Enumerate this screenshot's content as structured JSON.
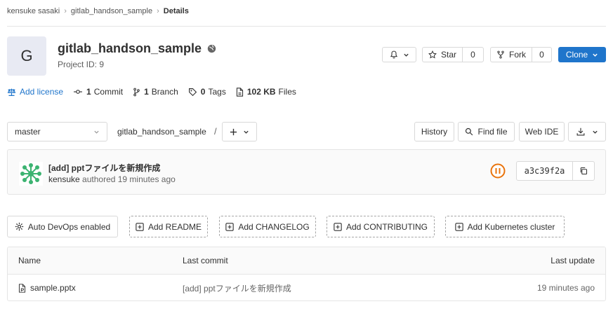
{
  "breadcrumb": {
    "items": [
      "kensuke sasaki",
      "gitlab_handson_sample"
    ],
    "current": "Details"
  },
  "project": {
    "avatar_letter": "G",
    "name": "gitlab_handson_sample",
    "id_label": "Project ID: 9"
  },
  "header_actions": {
    "star_label": "Star",
    "star_count": "0",
    "fork_label": "Fork",
    "fork_count": "0",
    "clone_label": "Clone"
  },
  "stats": {
    "add_license": "Add license",
    "commits_count": "1",
    "commits_label": "Commit",
    "branches_count": "1",
    "branches_label": "Branch",
    "tags_count": "0",
    "tags_label": "Tags",
    "files_size": "102 KB",
    "files_label": "Files"
  },
  "repo_nav": {
    "branch": "master",
    "path": "gitlab_handson_sample",
    "path_sep": "/",
    "history": "History",
    "find_file": "Find file",
    "web_ide": "Web IDE"
  },
  "last_commit": {
    "message": "[add] pptファイルを新規作成",
    "author": "kensuke",
    "meta": "authored 19 minutes ago",
    "sha": "a3c39f2a"
  },
  "quick_actions": {
    "auto_devops": "Auto DevOps enabled",
    "add_readme": "Add README",
    "add_changelog": "Add CHANGELOG",
    "add_contributing": "Add CONTRIBUTING",
    "add_kubernetes": "Add Kubernetes cluster"
  },
  "files_table": {
    "headers": {
      "name": "Name",
      "last_commit": "Last commit",
      "last_update": "Last update"
    },
    "rows": [
      {
        "name": "sample.pptx",
        "last_commit": "[add] pptファイルを新規作成",
        "last_update": "19 minutes ago"
      }
    ]
  },
  "colors": {
    "primary": "#1f75cb",
    "pipeline_running": "#e9730b",
    "avatar_bg": "#e8eaf3"
  }
}
